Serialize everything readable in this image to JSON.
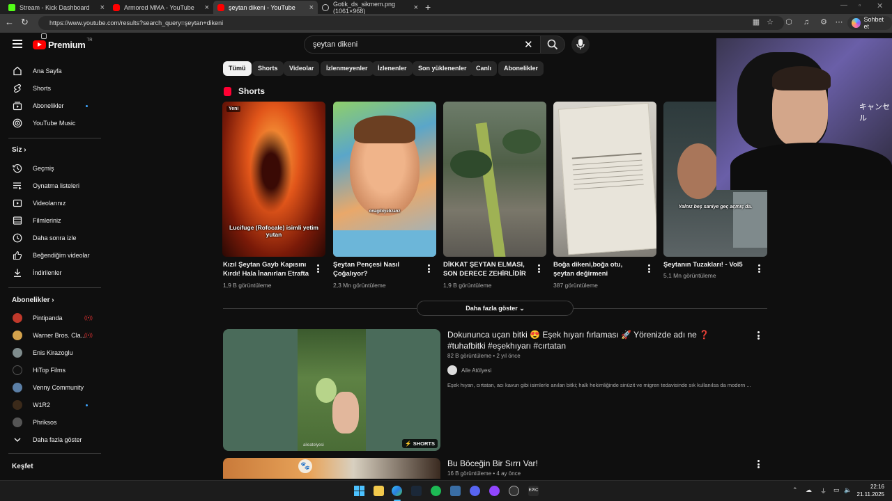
{
  "browser": {
    "tabs": [
      {
        "title": "Stream - Kick Dashboard",
        "active": false
      },
      {
        "title": "Armored MMA - YouTube",
        "active": false
      },
      {
        "title": "şeytan dikeni - YouTube",
        "active": true
      },
      {
        "title": "Gotik_ds_sikmem.png (1061×968)",
        "active": false
      }
    ],
    "new_tab": "+",
    "close_glyph": "×",
    "url": "https://www.youtube.com/results?search_query=şeytan+dikeni",
    "copilot_label": "Sohbet et"
  },
  "youtube": {
    "logo_text": "Premium",
    "logo_sup": "TR",
    "search_query": "şeytan dikeni",
    "sidebar": {
      "main": [
        {
          "label": "Ana Sayfa",
          "icon": "home-icon"
        },
        {
          "label": "Shorts",
          "icon": "shorts-icon"
        },
        {
          "label": "Abonelikler",
          "icon": "subscriptions-icon",
          "dot": true
        },
        {
          "label": "YouTube Music",
          "icon": "youtube-music-icon"
        }
      ],
      "you_heading": "Siz",
      "you": [
        {
          "label": "Geçmiş",
          "icon": "history-icon"
        },
        {
          "label": "Oynatma listeleri",
          "icon": "playlists-icon"
        },
        {
          "label": "Videolarınız",
          "icon": "your-videos-icon"
        },
        {
          "label": "Filmleriniz",
          "icon": "movies-icon"
        },
        {
          "label": "Daha sonra izle",
          "icon": "watch-later-icon"
        },
        {
          "label": "Beğendiğim videolar",
          "icon": "liked-icon"
        },
        {
          "label": "İndirilenler",
          "icon": "download-icon"
        }
      ],
      "subs_heading": "Abonelikler",
      "subs": [
        {
          "label": "Pintipanda",
          "live": true,
          "color": "#c0392b"
        },
        {
          "label": "Warner Bros. Cla...",
          "live": true,
          "color": "#d4a24c"
        },
        {
          "label": "Enis Kirazoglu",
          "live": false,
          "color": "#7f8c8d"
        },
        {
          "label": "HiTop Films",
          "live": false,
          "color": "#222222"
        },
        {
          "label": "Venny Community",
          "live": false,
          "color": "#5b7fa6"
        },
        {
          "label": "W1R2",
          "live": false,
          "dot": true,
          "color": "#3b2a1a"
        },
        {
          "label": "Phriksos",
          "live": false,
          "color": "#555555"
        }
      ],
      "show_more": "Daha fazla göster",
      "explore_heading": "Keşfet"
    },
    "chips": [
      "Tümü",
      "Shorts",
      "Videolar",
      "İzlenmeyenler",
      "İzlenenler",
      "Son yüklenenler",
      "Canlı",
      "Abonelikler"
    ],
    "shorts_heading": "Shorts",
    "shorts": [
      {
        "title": "Kızıl Şeytan Gayb Kapısını Kırdı! Hala İnanırları Etrafta",
        "views": "1,9 B görüntüleme",
        "badge": "Yeni",
        "caption": "Lucifuge (Rofocale) isimli yetim yutan"
      },
      {
        "title": "Şeytan Pençesi Nasıl Çoğalıyor?",
        "views": "2,3 Mn görüntüleme",
        "caption": "onagıbiyebzanz"
      },
      {
        "title": "DİKKAT ŞEYTAN ELMASI, SON DERECE ZEHİRLİDİR",
        "views": "1,9 B görüntüleme",
        "caption": ""
      },
      {
        "title": "Boğa dikeni,boğa otu, şeytan değirmeni",
        "views": "387 görüntüleme",
        "caption": ""
      },
      {
        "title": "Şeytanın Tuzakları! - Vol5",
        "views": "5,1 Mn görüntüleme",
        "caption": "Yalnız beş saniye geç açmış da."
      }
    ],
    "show_more_results": "Daha fazla göster",
    "videos": [
      {
        "title": "Dokununca uçan bitki 😍 Eşek hıyarı fırlaması 🚀 Yörenizde adı ne ❓ #tuhafbitki #eşekhıyarı #cırtatan",
        "meta": "82 B görüntüleme • 2 yıl önce",
        "channel": "Aile Atölyesi",
        "desc": "Eşek hıyarı, cırtatan, acı kavun gibi isimlerle anılan bitki; halk hekimliğinde sinüzit ve migren tedavisinde sık kullanılsa da modern ...",
        "badge": "SHORTS",
        "watermark": "aileatolyesi"
      },
      {
        "title": "Bu Böceğin Bir Sırrı Var!",
        "meta": "16 B görüntüleme • 4 ay önce"
      }
    ]
  },
  "taskbar": {
    "time": "22:16",
    "date": "21.11.2025"
  }
}
